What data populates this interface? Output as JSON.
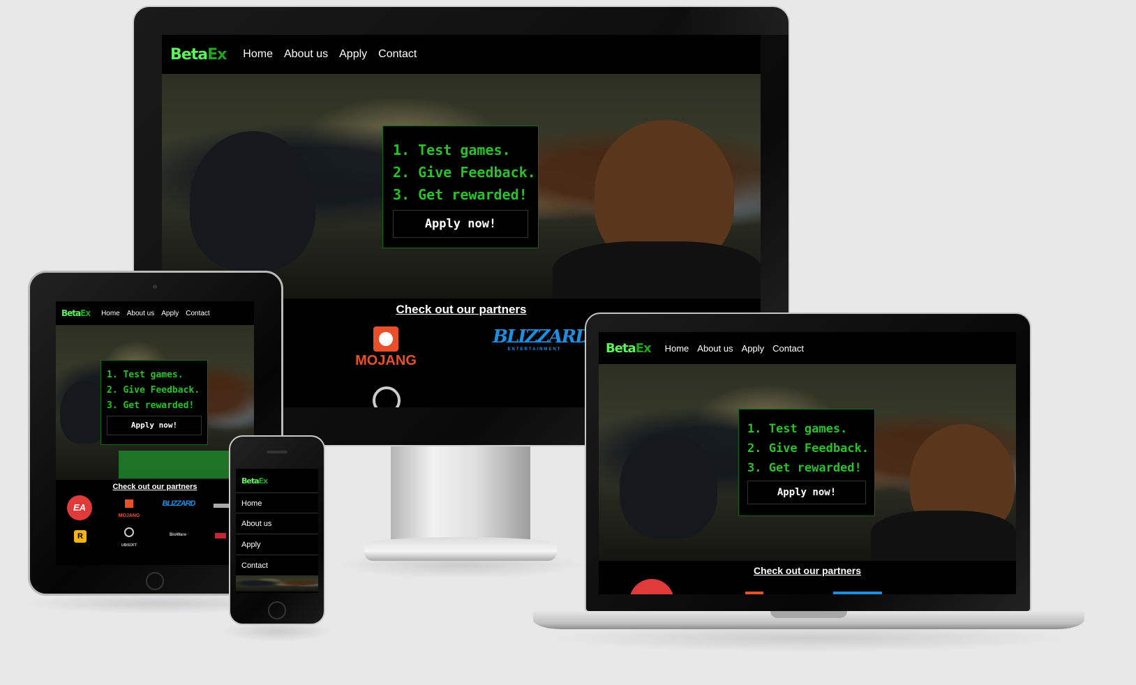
{
  "site": {
    "brand_part1": "Beta",
    "brand_part2": "Ex",
    "nav": [
      "Home",
      "About us",
      "Apply",
      "Contact"
    ],
    "hero": {
      "line1": "1. Test games.",
      "line2": "2. Give Feedback.",
      "line3": "3. Get rewarded!",
      "apply_label": "Apply now!"
    },
    "partners_title": "Check out our partners"
  },
  "logos": {
    "mojang": "MOJANG",
    "blizzard": "BLIZZARD",
    "blizzard_sub": "ENTERTAINMENT",
    "ea": "EA",
    "rockstar": "R",
    "ubisoft": "UBISOFT",
    "bioware": "BioWare"
  },
  "colors": {
    "brand_light": "#5cf25c",
    "brand_dark": "#1fa51f",
    "cta_text": "#29c229",
    "background": "#000000",
    "page_bg": "#e8e8e9",
    "mojang": "#e8502a",
    "blizzard": "#1e8fe0",
    "ea": "#e03a3a"
  }
}
